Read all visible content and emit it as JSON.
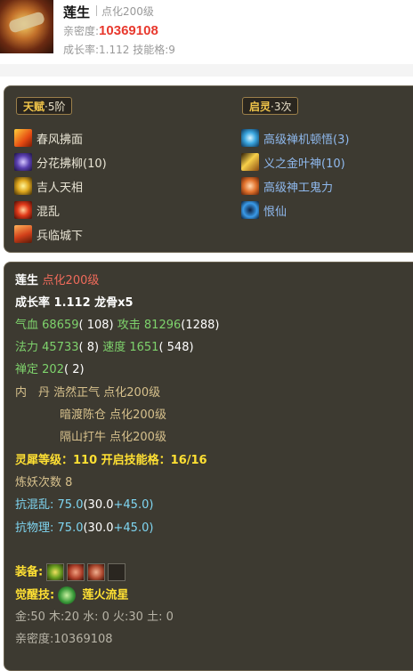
{
  "header": {
    "name": "莲生",
    "level": "点化200级",
    "intimacy_label": "亲密度:",
    "intimacy_value": "10369108",
    "growth_line": "成长率:1.112 技能格:9"
  },
  "talent": {
    "title": "天赋",
    "rank": "·5阶",
    "skills": [
      "春风拂面",
      "分花拂柳(10)",
      "吉人天相",
      "混乱",
      "兵临城下"
    ]
  },
  "awaken": {
    "title": "启灵",
    "count": "·3次",
    "skills": [
      "高级禅机顿悟(3)",
      "义之金叶神(10)",
      "高级神工鬼力",
      "恨仙"
    ]
  },
  "details": {
    "name": "莲生",
    "level": "点化200级",
    "growth": "成长率 1.112 龙骨x5",
    "hp_label": "气血",
    "hp_value": "68659",
    "hp_bonus": "( 108)",
    "atk_label": "攻击",
    "atk_value": "81296",
    "atk_bonus": "(1288)",
    "mp_label": "法力",
    "mp_value": "45733",
    "mp_bonus": "( 8)",
    "spd_label": "速度",
    "spd_value": "1651",
    "spd_bonus": "( 548)",
    "zen_label": "禅定",
    "zen_value": "202",
    "zen_bonus": "( 2)",
    "dan_label": "内　丹",
    "dan1": "浩然正气 点化200级",
    "dan2": "暗渡陈仓 点化200级",
    "dan3": "隔山打牛 点化200级",
    "lingxi": "灵犀等级：110 开启技能格：16/16",
    "lianyao": "炼妖次数 8",
    "kanghunluan_label": "抗混乱:",
    "kanghunluan_total": "75.0",
    "kanghunluan_a": "(30.0",
    "kanghunluan_b": "+45.0)",
    "kangwuli_label": "抗物理:",
    "kangwuli_total": "75.0",
    "kangwuli_a": "(30.0",
    "kangwuli_b": "+45.0)",
    "equip_label": "装备:",
    "juexing_label": "觉醒技:",
    "juexing_skill": "莲火流星",
    "elements": "金:50 木:20 水: 0 火:30 土: 0",
    "intimacy_line": "亲密度:10369108"
  },
  "icons": {
    "talent": [
      "wind-icon",
      "flower-icon",
      "star-icon",
      "chaos-icon",
      "city-icon"
    ],
    "awaken": [
      "zen-icon",
      "gold-leaf-icon",
      "ghost-power-icon",
      "hate-icon"
    ]
  }
}
